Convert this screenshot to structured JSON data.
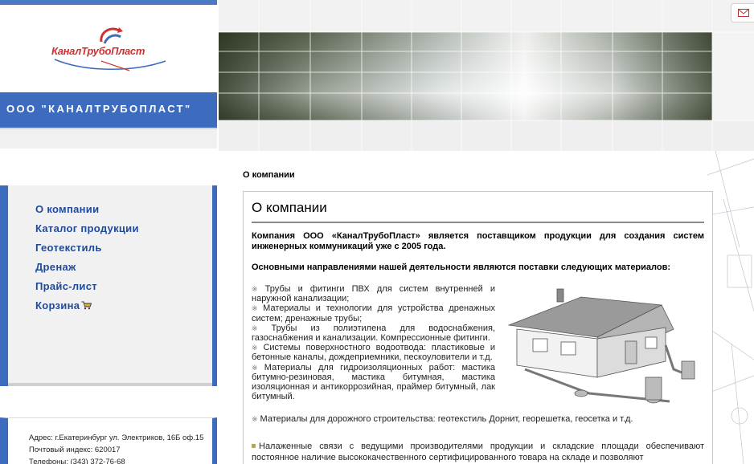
{
  "header": {
    "logo_text": "КаналТрубоПласт",
    "company_name": "ООО \"КАНАЛТРУБОПЛАСТ\""
  },
  "nav": {
    "items": [
      {
        "label": "О компании"
      },
      {
        "label": "Каталог продукции"
      },
      {
        "label": "Геотекстиль"
      },
      {
        "label": "Дренаж"
      },
      {
        "label": "Прайс-лист"
      },
      {
        "label": "Корзина"
      }
    ]
  },
  "address": {
    "line1": "Адрес: г.Екатеринбург ул. Электриков, 16Б оф.15",
    "line2": "Почтовый индекс: 620017",
    "line3": "Телефоны: (343) 372-76-68"
  },
  "breadcrumb": "О компании",
  "content": {
    "title": "О компании",
    "intro": "Компания ООО «КаналТрубоПласт» является поставщиком продукции для создания систем инженерных коммуникаций уже с 2005 года.",
    "directions": "Основными направлениями нашей деятельности являются поставки следующих материалов:",
    "materials": [
      "Трубы и фитинги ПВХ для систем внутренней и наружной канализации;",
      "Материалы и технологии для устройства дренажных систем; дренажные трубы;",
      "Трубы из полиэтилена для водоснабжения, газоснабжения и канализации. Компрессионные фитинги.",
      "Системы поверхностного водоотвода: пластиковые и бетонные каналы, дождеприемники, пескоуловители и т.д.",
      "Материалы для гидроизоляционных работ: мастика битумно-резиновая, мастика битумная, мастика изоляционная и антикоррозийная, праймер битумный, лак битумный."
    ],
    "last_material": "Материалы для дорожного строительства: геотекстиль Дорнит, георешетка, геосетка и т.д.",
    "bottom_para": "Налаженные связи с ведущими производителями продукции и складские площади обеспечивают постоянное наличие высококачественного сертифицированного товара на складе и позволяют"
  },
  "colors": {
    "brand_blue": "#3d6cbf",
    "nav_text": "#1f4a9a",
    "logo_red": "#d03030"
  },
  "icons": {
    "cart": "cart-icon",
    "mail": "mail-icon"
  }
}
